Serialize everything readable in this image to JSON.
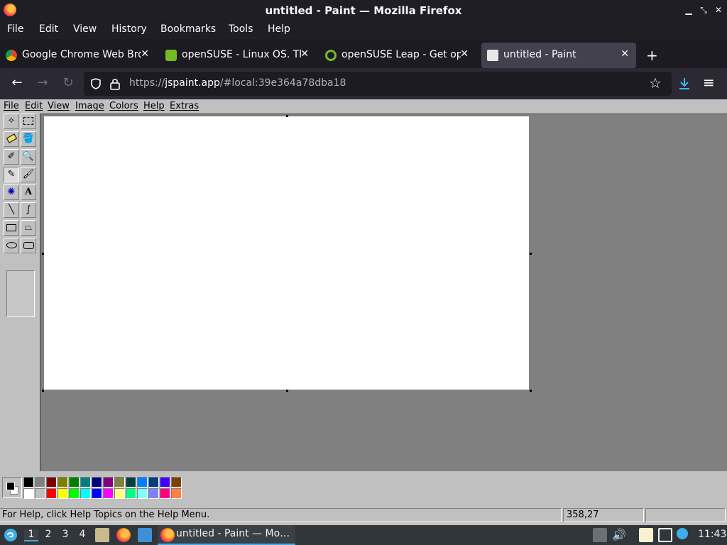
{
  "window": {
    "title": "untitled - Paint — Mozilla Firefox"
  },
  "menu": [
    "File",
    "Edit",
    "View",
    "History",
    "Bookmarks",
    "Tools",
    "Help"
  ],
  "tabs": [
    {
      "label": "Google Chrome Web Bro…",
      "icon": "chrome-icon"
    },
    {
      "label": "openSUSE - Linux OS. Th…",
      "icon": "opensuse-icon"
    },
    {
      "label": "openSUSE Leap - Get op…",
      "icon": "opensuse-leap-icon"
    },
    {
      "label": "untitled - Paint",
      "icon": "jspaint-icon"
    }
  ],
  "url": {
    "prefix": "https://",
    "host": "jspaint.app",
    "path": "/#local:39e364a78dba18"
  },
  "paint": {
    "menu": [
      "File",
      "Edit",
      "View",
      "Image",
      "Colors",
      "Help",
      "Extras"
    ],
    "tools": [
      "free-form-select",
      "rectangle-select",
      "eraser",
      "fill-with-color",
      "pick-color",
      "magnifier",
      "pencil",
      "brush",
      "airbrush",
      "text",
      "line",
      "curve",
      "rectangle",
      "polygon",
      "ellipse",
      "rounded-rectangle"
    ],
    "selected_tool": "pencil",
    "palette": {
      "row1": [
        "#000000",
        "#808080",
        "#800000",
        "#808000",
        "#008000",
        "#008080",
        "#000080",
        "#800080",
        "#808040",
        "#004040",
        "#0080ff",
        "#004080",
        "#4000ff",
        "#804000"
      ],
      "row2": [
        "#ffffff",
        "#c0c0c0",
        "#ff0000",
        "#ffff00",
        "#00ff00",
        "#00ffff",
        "#0000ff",
        "#ff00ff",
        "#ffff80",
        "#00ff80",
        "#80ffff",
        "#8080ff",
        "#ff0080",
        "#ff8040"
      ]
    },
    "foreground": "#000000",
    "background": "#ffffff",
    "status": {
      "help": "For Help, click Help Topics on the Help Menu.",
      "coords": "358,27",
      "size": ""
    }
  },
  "taskbar": {
    "workspaces": [
      "1",
      "2",
      "3",
      "4"
    ],
    "active_workspace": "1",
    "window_label": "untitled - Paint — Mo…",
    "clock": "11:43"
  }
}
